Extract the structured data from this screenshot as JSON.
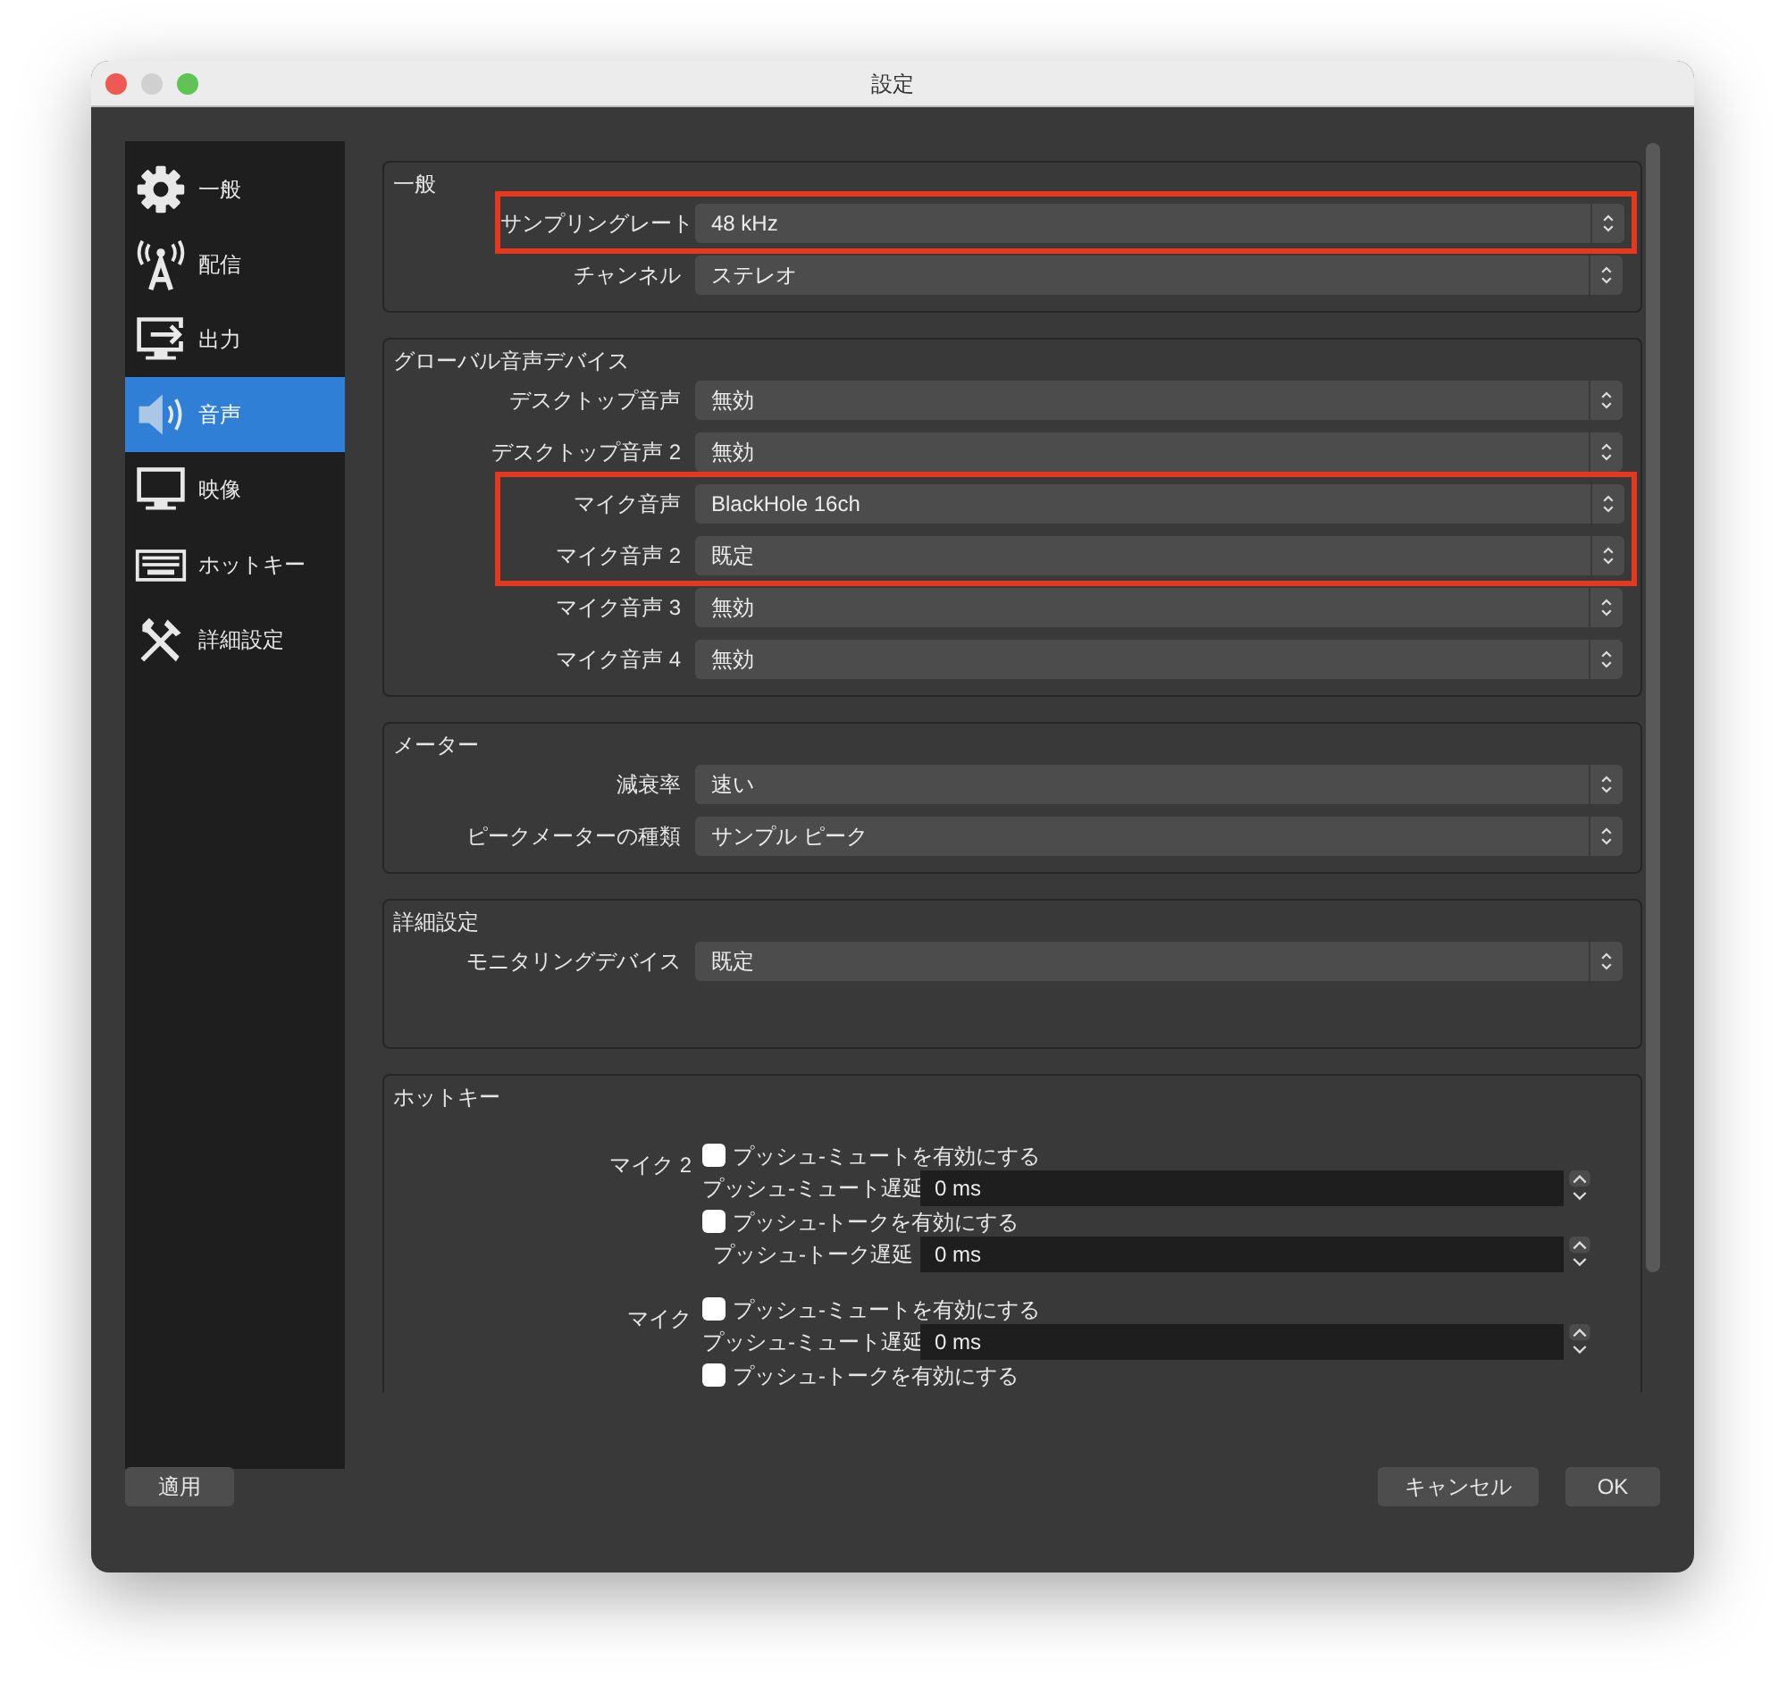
{
  "window": {
    "title": "設定"
  },
  "sidebar": {
    "items": [
      {
        "label": "一般",
        "kind": "gear",
        "selected": false
      },
      {
        "label": "配信",
        "kind": "antenna",
        "selected": false
      },
      {
        "label": "出力",
        "kind": "output",
        "selected": false
      },
      {
        "label": "音声",
        "kind": "speaker",
        "selected": true
      },
      {
        "label": "映像",
        "kind": "monitor",
        "selected": false
      },
      {
        "label": "ホットキー",
        "kind": "keyboard",
        "selected": false
      },
      {
        "label": "詳細設定",
        "kind": "tools",
        "selected": false
      }
    ]
  },
  "groups": [
    {
      "title": "一般",
      "rows": [
        {
          "label": "サンプリングレート",
          "value": "48 kHz",
          "highlighted": true
        },
        {
          "label": "チャンネル",
          "value": "ステレオ",
          "highlighted": false
        }
      ]
    },
    {
      "title": "グローバル音声デバイス",
      "rows": [
        {
          "label": "デスクトップ音声",
          "value": "無効",
          "highlighted": false
        },
        {
          "label": "デスクトップ音声 2",
          "value": "無効",
          "highlighted": false
        },
        {
          "label": "マイク音声",
          "value": "BlackHole 16ch",
          "highlighted": true
        },
        {
          "label": "マイク音声 2",
          "value": "既定",
          "highlighted": true
        },
        {
          "label": "マイク音声 3",
          "value": "無効",
          "highlighted": false
        },
        {
          "label": "マイク音声 4",
          "value": "無効",
          "highlighted": false
        }
      ]
    },
    {
      "title": "メーター",
      "rows": [
        {
          "label": "減衰率",
          "value": "速い",
          "highlighted": false
        },
        {
          "label": "ピークメーターの種類",
          "value": "サンプル ピーク",
          "highlighted": false
        }
      ]
    },
    {
      "title": "詳細設定",
      "rows": [
        {
          "label": "モニタリングデバイス",
          "value": "既定",
          "highlighted": false
        }
      ]
    }
  ],
  "hotkeys": {
    "title": "ホットキー",
    "entries": [
      {
        "label": "マイク 2",
        "items": [
          {
            "kind": "checkbox",
            "label": "プッシュ-ミュートを有効にする",
            "checked": false
          },
          {
            "kind": "spin",
            "label": "プッシュ-ミュート遅延",
            "value": "0 ms"
          },
          {
            "kind": "checkbox",
            "label": "プッシュ-トークを有効にする",
            "checked": false
          },
          {
            "kind": "spin",
            "label": "プッシュ-トーク遅延",
            "value": "0 ms"
          }
        ]
      },
      {
        "label": "マイク",
        "items": [
          {
            "kind": "checkbox",
            "label": "プッシュ-ミュートを有効にする",
            "checked": false
          },
          {
            "kind": "spin",
            "label": "プッシュ-ミュート遅延",
            "value": "0 ms"
          },
          {
            "kind": "checkbox",
            "label": "プッシュ-トークを有効にする",
            "checked": false
          }
        ]
      }
    ]
  },
  "buttons": {
    "apply": "適用",
    "cancel": "キャンセル",
    "ok": "OK"
  }
}
